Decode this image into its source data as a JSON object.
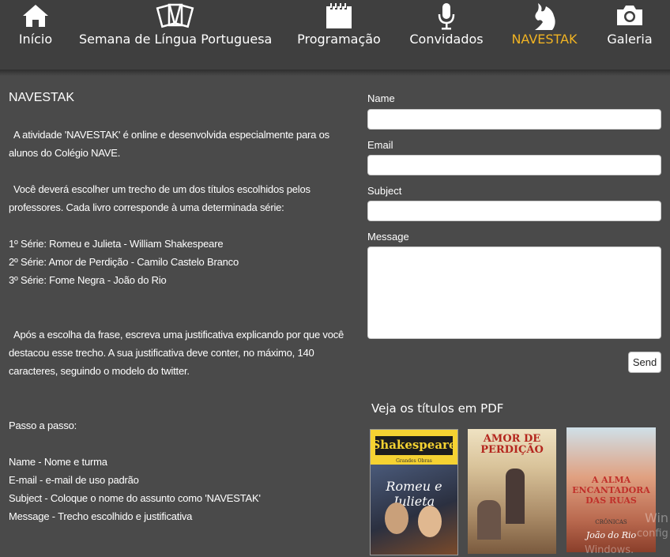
{
  "nav": {
    "items": [
      {
        "label": "Início",
        "icon": "home-icon"
      },
      {
        "label": "Semana de Língua Portuguesa",
        "icon": "cards-icon"
      },
      {
        "label": "Programação",
        "icon": "calendar-icon"
      },
      {
        "label": "Convidados",
        "icon": "microphone-icon"
      },
      {
        "label": "NAVESTAK",
        "icon": "silhouette-icon",
        "active": true
      },
      {
        "label": "Galeria",
        "icon": "camera-icon"
      }
    ],
    "active_color": "#f0b323"
  },
  "content": {
    "title": "NAVESTAK",
    "intro": "A atividade 'NAVESTAK' é online e desenvolvida especialmente para os alunos do Colégio NAVE.",
    "choose": "Você deverá escolher um trecho de um dos títulos escolhidos pelos professores. Cada livro corresponde à uma determinada série:",
    "series": [
      "1º Série: Romeu e Julieta - William Shakespeare",
      "2º Série: Amor de Perdição - Camilo Castelo Branco",
      "3º Série: Fome Negra - João do Rio"
    ],
    "justify": "Após a escolha da frase, escreva uma justificativa explicando por que você destacou esse trecho. A sua justificativa deve conter, no máximo, 140 caracteres, seguindo o modelo do twitter.",
    "steps_title": "Passo a passo:",
    "steps": [
      "Name - Nome e turma",
      "E-mail - e-mail de uso padrão",
      "Subject - Coloque o nome do assunto como 'NAVESTAK'",
      "Message - Trecho escolhido e justificativa"
    ]
  },
  "form": {
    "name_label": "Name",
    "name_value": "",
    "email_label": "Email",
    "email_value": "",
    "subject_label": "Subject",
    "subject_value": "",
    "message_label": "Message",
    "message_value": "",
    "send_label": "Send"
  },
  "pdf": {
    "title": "Veja os títulos em PDF",
    "books": [
      {
        "cover_title": "Shakespeare",
        "cover_subtitle": "Romeu e Julieta",
        "cover_text_small": "Grandes Obras"
      },
      {
        "cover_title": "AMOR DE PERDIÇÃO"
      },
      {
        "cover_title": "A ALMA ENCANTADORA DAS RUAS",
        "cover_subtitle": "CRÔNICAS",
        "cover_author": "João do Rio"
      }
    ]
  },
  "watermark": {
    "line1": "Win",
    "line2": "config",
    "line3": "Windows."
  }
}
